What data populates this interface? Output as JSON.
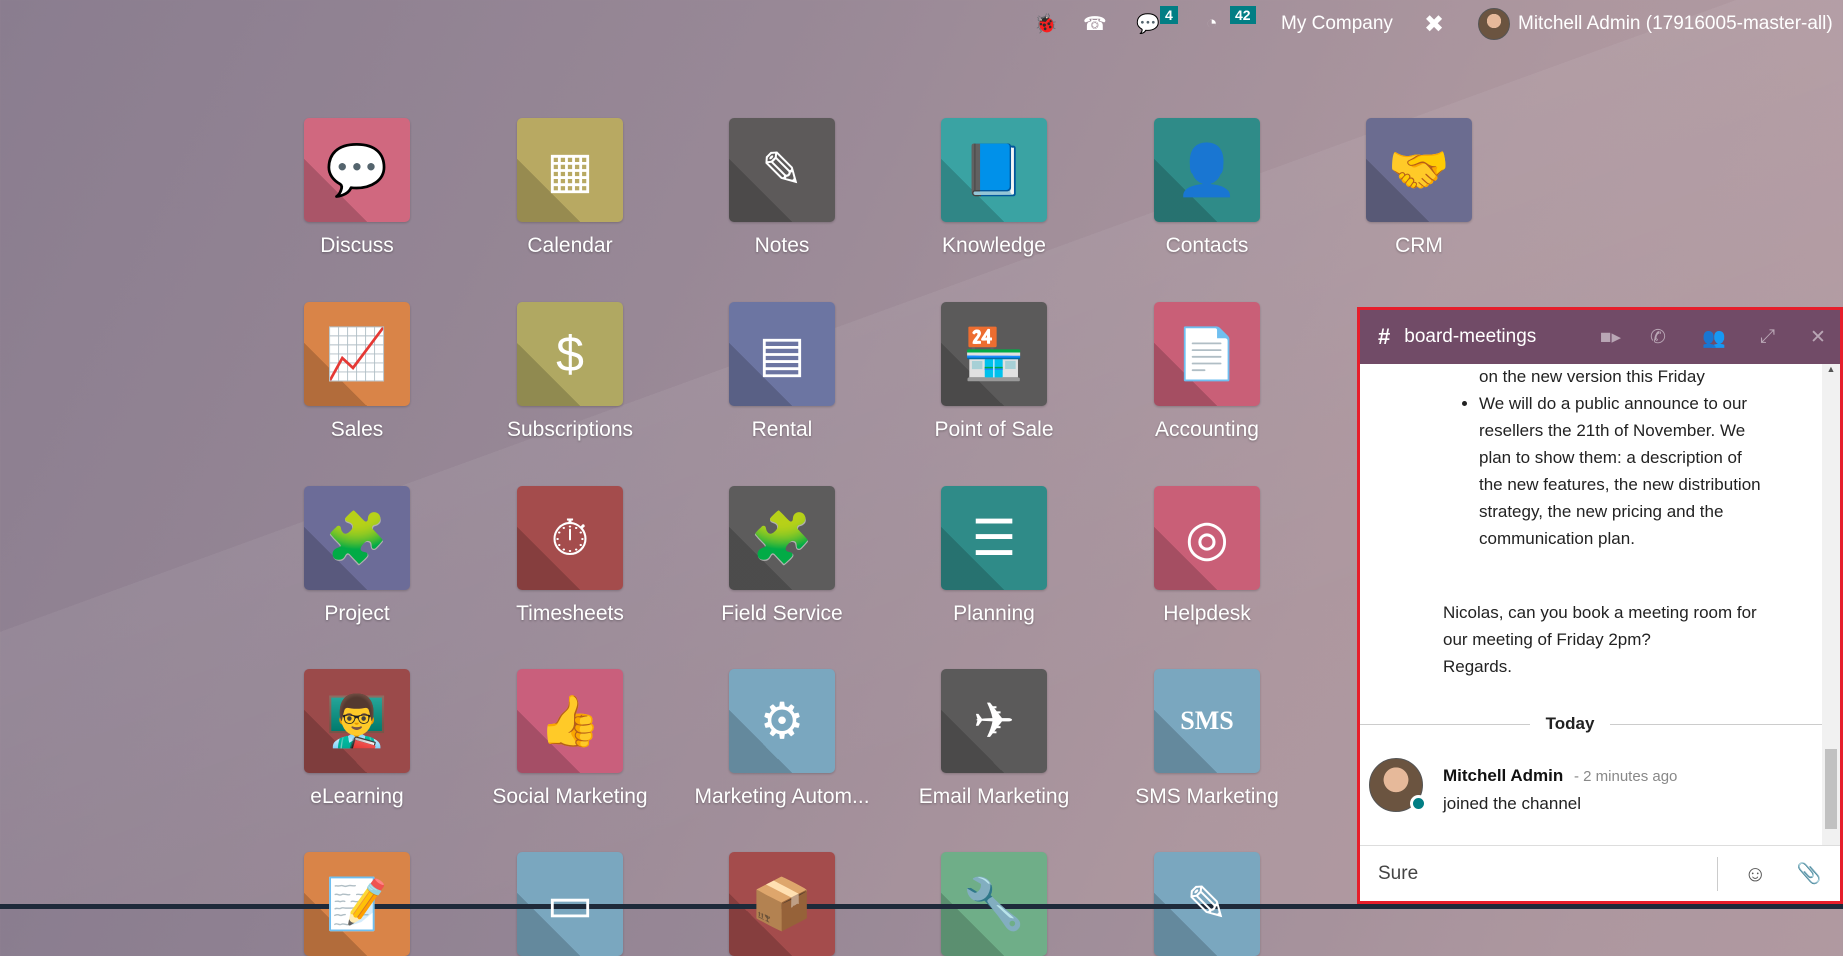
{
  "topbar": {
    "icons": [
      "bug-icon",
      "phone-icon",
      "chat-icon",
      "clock-icon",
      "tools-icon"
    ],
    "messages_count": "4",
    "activities_count": "42",
    "company": "My Company",
    "user": "Mitchell Admin (17916005-master-all)"
  },
  "apps": [
    {
      "label": "Discuss",
      "color": "#d0687f",
      "glyph": "💬"
    },
    {
      "label": "Calendar",
      "color": "#b8a962",
      "glyph": "▦"
    },
    {
      "label": "Notes",
      "color": "#5d5a5a",
      "glyph": "✎"
    },
    {
      "label": "Knowledge",
      "color": "#3aa3a3",
      "glyph": "📘"
    },
    {
      "label": "Contacts",
      "color": "#2f8b88",
      "glyph": "👤"
    },
    {
      "label": "CRM",
      "color": "#6b6c90",
      "glyph": "🤝"
    },
    {
      "label": "Sales",
      "color": "#d98448",
      "glyph": "📈"
    },
    {
      "label": "Subscriptions",
      "color": "#b0a862",
      "glyph": "$"
    },
    {
      "label": "Rental",
      "color": "#6c75a2",
      "glyph": "▤"
    },
    {
      "label": "Point of Sale",
      "color": "#5b5a5a",
      "glyph": "🏪"
    },
    {
      "label": "Accounting",
      "color": "#c95f77",
      "glyph": "📄"
    },
    {
      "label": "Project",
      "color": "#6c6c98",
      "glyph": "🧩"
    },
    {
      "label": "Timesheets",
      "color": "#a44c4c",
      "glyph": "⏱"
    },
    {
      "label": "Field Service",
      "color": "#5d5c5c",
      "glyph": "🧩"
    },
    {
      "label": "Planning",
      "color": "#2f8b88",
      "glyph": "☰"
    },
    {
      "label": "Helpdesk",
      "color": "#c95f77",
      "glyph": "◎"
    },
    {
      "label": "eLearning",
      "color": "#9b4a4a",
      "glyph": "👨‍🏫"
    },
    {
      "label": "Social Marketing",
      "color": "#c95f7c",
      "glyph": "👍"
    },
    {
      "label": "Marketing Autom...",
      "color": "#7aa7bf",
      "glyph": "⚙"
    },
    {
      "label": "Email Marketing",
      "color": "#5b5a5a",
      "glyph": "✈"
    },
    {
      "label": "SMS Marketing",
      "color": "#7aa7bf",
      "glyph": "SMS"
    },
    {
      "label": "",
      "color": "#d98448",
      "glyph": "📝"
    },
    {
      "label": "",
      "color": "#7aa7bf",
      "glyph": "▭"
    },
    {
      "label": "",
      "color": "#a44c4c",
      "glyph": "📦"
    },
    {
      "label": "",
      "color": "#6fae88",
      "glyph": "🔧"
    },
    {
      "label": "",
      "color": "#7aa7bf",
      "glyph": "✎"
    }
  ],
  "chat": {
    "channel": "board-meetings",
    "header_icons": [
      "video-icon",
      "phone-icon",
      "members-icon",
      "expand-icon",
      "close-icon"
    ],
    "list_tail": "on the new version this Friday",
    "bullet": "We will do a public announce to our resellers the 21th of November. We plan to show them: a description of the new features, the new distribution strategy, the new pricing and the communication plan.",
    "paragraph_lines": [
      "Nicolas, can you book a meeting room for",
      "our meeting of Friday 2pm?",
      "Regards."
    ],
    "separator": "Today",
    "message": {
      "author": "Mitchell Admin",
      "time": "- 2 minutes ago",
      "text": "joined the channel"
    },
    "composer_value": "Sure",
    "accent": "#714b67",
    "border": "#e61e2b",
    "online": "#017e84"
  }
}
